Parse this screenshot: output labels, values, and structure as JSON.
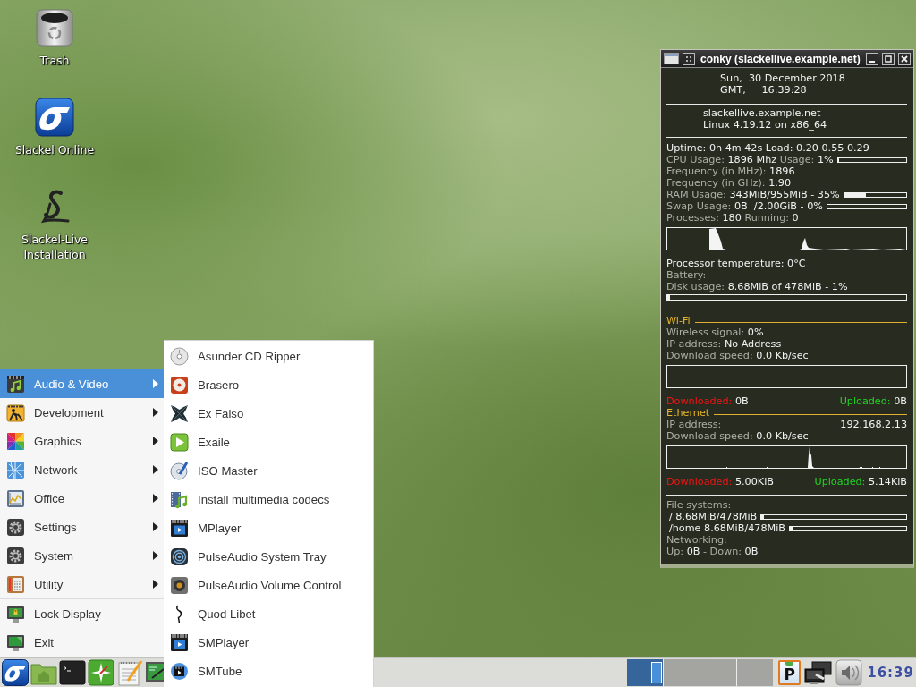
{
  "desktop_icons": [
    {
      "label": "Trash"
    },
    {
      "label": "Slackel Online"
    },
    {
      "label": "Slackel-Live Installation"
    }
  ],
  "conky": {
    "title": "conky (slackellive.example.net)",
    "date": "Sun,  30 December 2018",
    "time": "GMT,     16:39:28",
    "host": [
      "slackellive.example.net -",
      "Linux 4.19.12 on x86_64"
    ],
    "rows": [
      {
        "kind": "line",
        "segments": [
          {
            "kind": "value",
            "text": "Uptime: 0h 4m 42s Load: 0.20 0.55 0.29"
          }
        ]
      },
      {
        "kind": "bar",
        "segments": [
          {
            "kind": "label",
            "text": "CPU Usage:"
          },
          {
            "kind": "value",
            "text": "1896 Mhz"
          },
          {
            "kind": "label",
            "text": "Usage:"
          },
          {
            "kind": "value",
            "text": "1%"
          }
        ],
        "level": 0.01
      },
      {
        "kind": "line",
        "segments": [
          {
            "kind": "label",
            "text": "Frequency (in MHz):"
          },
          {
            "kind": "value",
            "text": "1896"
          }
        ]
      },
      {
        "kind": "line",
        "segments": [
          {
            "kind": "label",
            "text": "Frequency (in GHz):"
          },
          {
            "kind": "value",
            "text": "1.90"
          }
        ]
      },
      {
        "kind": "bar",
        "segments": [
          {
            "kind": "label",
            "text": "RAM Usage:"
          },
          {
            "kind": "value",
            "text": "343MiB/955MiB - 35%"
          }
        ],
        "level": 0.35
      },
      {
        "kind": "bar",
        "segments": [
          {
            "kind": "label",
            "text": "Swap Usage:"
          },
          {
            "kind": "value",
            "text": "0B  /2.00GiB - 0%"
          }
        ],
        "level": 0
      },
      {
        "kind": "line",
        "segments": [
          {
            "kind": "label",
            "text": "Processes:"
          },
          {
            "kind": "value",
            "text": "180"
          },
          {
            "kind": "label",
            "text": "Running:"
          },
          {
            "kind": "value",
            "text": "0"
          }
        ]
      },
      {
        "kind": "graph"
      },
      {
        "kind": "line",
        "segments": [
          {
            "kind": "value",
            "text": "Processor temperature: 0°C"
          }
        ]
      },
      {
        "kind": "line",
        "segments": [
          {
            "kind": "label",
            "text": "Battery:"
          }
        ]
      },
      {
        "kind": "line",
        "segments": [
          {
            "kind": "label",
            "text": "Disk usage:"
          },
          {
            "kind": "value",
            "text": "8.68MiB of 478MiB - 1%"
          }
        ]
      },
      {
        "kind": "fullbar",
        "level": 0.01
      },
      {
        "kind": "heading",
        "text": "Wi-Fi"
      },
      {
        "kind": "line",
        "segments": [
          {
            "kind": "label",
            "text": "Wireless signal:"
          },
          {
            "kind": "value",
            "text": "0%"
          }
        ]
      },
      {
        "kind": "line",
        "segments": [
          {
            "kind": "label",
            "text": "IP address:"
          },
          {
            "kind": "value",
            "text": "No Address"
          }
        ]
      },
      {
        "kind": "line",
        "segments": [
          {
            "kind": "label",
            "text": "Download speed:"
          },
          {
            "kind": "value",
            "text": "0.0 Kb/sec"
          }
        ]
      },
      {
        "kind": "graph"
      },
      {
        "kind": "split",
        "left": [
          {
            "kind": "down",
            "text": "Downloaded:"
          },
          {
            "kind": "value",
            "text": "0B"
          }
        ],
        "right": [
          {
            "kind": "up",
            "text": "Uploaded:"
          },
          {
            "kind": "value",
            "text": "0B"
          }
        ]
      },
      {
        "kind": "heading",
        "text": "Ethernet"
      },
      {
        "kind": "split",
        "left": [
          {
            "kind": "label",
            "text": "IP address:"
          }
        ],
        "right": [
          {
            "kind": "value",
            "text": "192.168.2.13"
          }
        ]
      },
      {
        "kind": "line",
        "segments": [
          {
            "kind": "label",
            "text": "Download speed:"
          },
          {
            "kind": "value",
            "text": "0.0 Kb/sec"
          }
        ]
      },
      {
        "kind": "graph"
      },
      {
        "kind": "split",
        "left": [
          {
            "kind": "down",
            "text": "Downloaded:"
          },
          {
            "kind": "value",
            "text": "5.00KiB"
          }
        ],
        "right": [
          {
            "kind": "up",
            "text": "Uploaded:"
          },
          {
            "kind": "value",
            "text": "5.14KiB"
          }
        ]
      },
      {
        "kind": "rule"
      },
      {
        "kind": "line",
        "segments": [
          {
            "kind": "label",
            "text": "File systems:"
          }
        ]
      },
      {
        "kind": "bar",
        "segments": [
          {
            "kind": "value",
            "text": "/ 8.68MiB/478MiB"
          }
        ],
        "level": 0.02
      },
      {
        "kind": "bar",
        "segments": [
          {
            "kind": "value",
            "text": "/home 8.68MiB/478MiB"
          }
        ],
        "level": 0.02
      },
      {
        "kind": "line",
        "segments": [
          {
            "kind": "label",
            "text": "Networking:"
          }
        ]
      },
      {
        "kind": "line",
        "segments": [
          {
            "kind": "label",
            "text": "Up:"
          },
          {
            "kind": "value",
            "text": "0B"
          },
          {
            "kind": "label",
            "text": "- Down:"
          },
          {
            "kind": "value",
            "text": "0B"
          }
        ]
      }
    ]
  },
  "menu": {
    "categories": [
      {
        "label": "Audio & Video",
        "selected": true
      },
      {
        "label": "Development",
        "selected": false
      },
      {
        "label": "Graphics",
        "selected": false
      },
      {
        "label": "Network",
        "selected": false
      },
      {
        "label": "Office",
        "selected": false
      },
      {
        "label": "Settings",
        "selected": false
      },
      {
        "label": "System",
        "selected": false
      },
      {
        "label": "Utility",
        "selected": false
      }
    ],
    "actions": [
      {
        "label": "Lock Display",
        "selected": false
      },
      {
        "label": "Exit",
        "selected": false
      }
    ]
  },
  "submenu": {
    "items": [
      {
        "label": "Asunder CD Ripper",
        "selected": false
      },
      {
        "label": "Brasero",
        "selected": false
      },
      {
        "label": "Ex Falso",
        "selected": false
      },
      {
        "label": "Exaile",
        "selected": false
      },
      {
        "label": "ISO Master",
        "selected": false
      },
      {
        "label": "Install multimedia codecs",
        "selected": false
      },
      {
        "label": "MPlayer",
        "selected": false
      },
      {
        "label": "PulseAudio System Tray",
        "selected": false
      },
      {
        "label": "PulseAudio Volume Control",
        "selected": false
      },
      {
        "label": "Quod Libet",
        "selected": false
      },
      {
        "label": "SMPlayer",
        "selected": false
      },
      {
        "label": "SMTube",
        "selected": false
      }
    ]
  },
  "taskbar": {
    "workspaces": [
      {
        "selected": true,
        "has_window": true
      },
      {
        "selected": false,
        "has_window": false
      },
      {
        "selected": false,
        "has_window": false
      },
      {
        "selected": false,
        "has_window": false
      }
    ],
    "clipboard_letter": "P",
    "clock": "16:39"
  }
}
